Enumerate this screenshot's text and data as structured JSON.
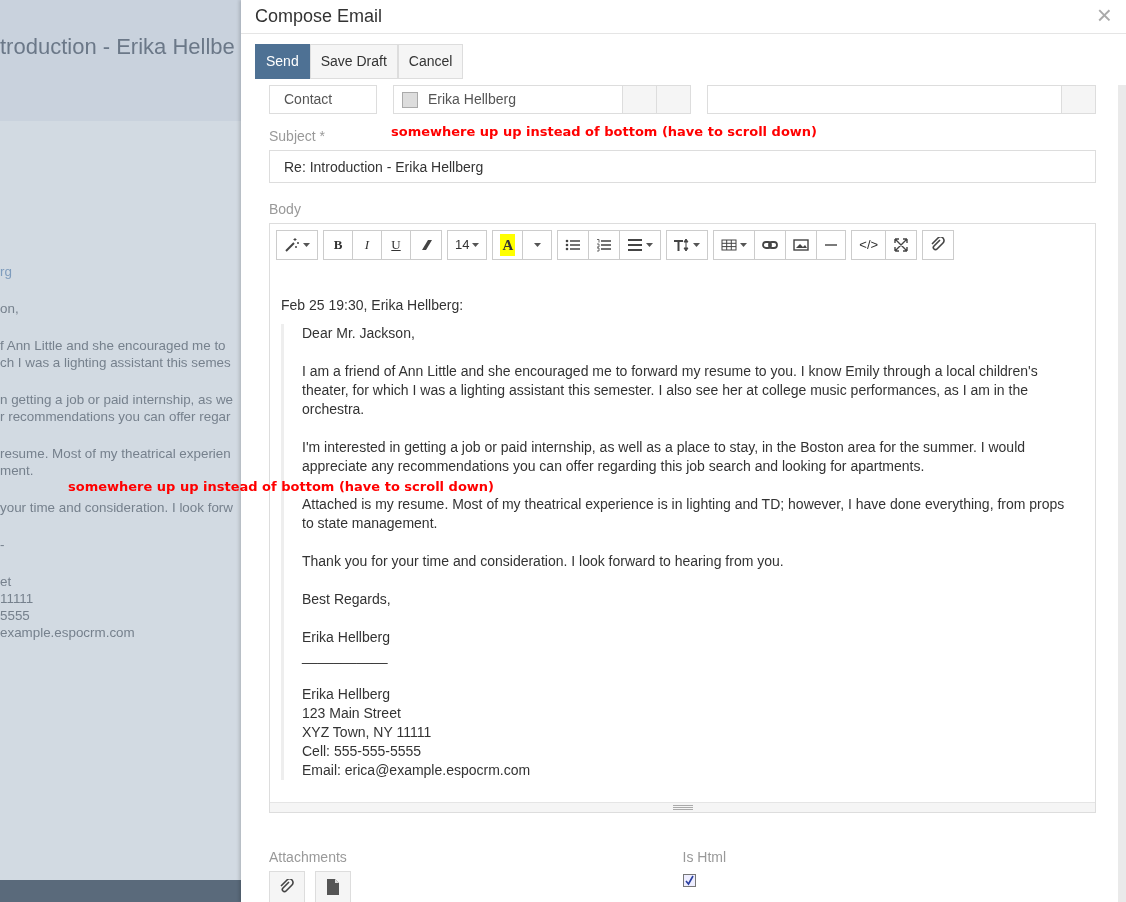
{
  "background_page": {
    "title": "troduction - Erika Hellbe",
    "paragraphs": [
      {
        "kind": "link",
        "lines": [
          "rg"
        ]
      },
      {
        "kind": "text",
        "lines": [
          "on,"
        ]
      },
      {
        "kind": "text",
        "lines": [
          "f Ann Little and she encouraged me to",
          "ch I was a lighting assistant this semes"
        ]
      },
      {
        "kind": "text",
        "lines": [
          "n getting a job or paid internship, as we",
          "r recommendations you can offer regar"
        ]
      },
      {
        "kind": "text",
        "lines": [
          "resume. Most of my theatrical experien",
          "ment."
        ]
      },
      {
        "kind": "text",
        "lines": [
          "your time and consideration. I look forw"
        ]
      },
      {
        "kind": "text",
        "lines": [
          "-"
        ]
      },
      {
        "kind": "text",
        "lines": [
          "et",
          "11111",
          "5555",
          "example.espocrm.com"
        ]
      }
    ]
  },
  "modal": {
    "title": "Compose Email",
    "close": "×",
    "buttons": [
      {
        "label": "Send",
        "kind": "primary"
      },
      {
        "label": "Save Draft",
        "kind": "default"
      },
      {
        "label": "Cancel",
        "kind": "default"
      }
    ],
    "parent_row": {
      "type": "Contact",
      "name": "Erika Hellberg",
      "checked": false
    },
    "subject": {
      "label": "Subject *",
      "value": "Re: Introduction - Erika Hellberg"
    },
    "body": {
      "label": "Body",
      "toolbar": [
        [
          {
            "kind": "wand",
            "caret": true
          }
        ],
        [
          {
            "kind": "bold",
            "label": "B",
            "caret": false
          },
          {
            "kind": "italic",
            "label": "I",
            "caret": false
          },
          {
            "kind": "underline",
            "label": "U",
            "caret": false
          },
          {
            "kind": "eraser",
            "caret": false
          }
        ],
        [
          {
            "kind": "text",
            "label": "14",
            "caret": true
          }
        ],
        [
          {
            "kind": "highlight",
            "label": "A",
            "caret": false
          },
          {
            "kind": "more",
            "caret": true
          }
        ],
        [
          {
            "kind": "bullets",
            "caret": false
          },
          {
            "kind": "numbers",
            "caret": false
          },
          {
            "kind": "align",
            "caret": true
          }
        ],
        [
          {
            "kind": "height",
            "caret": true
          }
        ],
        [
          {
            "kind": "table",
            "caret": true
          },
          {
            "kind": "link",
            "caret": false
          },
          {
            "kind": "picture",
            "caret": false
          },
          {
            "kind": "rule",
            "caret": false
          }
        ],
        [
          {
            "kind": "text",
            "label": "</>",
            "caret": false
          },
          {
            "kind": "fullscreen",
            "caret": false
          }
        ],
        [
          {
            "kind": "attach",
            "caret": false
          }
        ]
      ],
      "quote_header": "Feb 25 19:30, Erika Hellberg:",
      "quote": [
        [
          "Dear Mr. Jackson,"
        ],
        [
          "I am a friend of Ann Little and she encouraged me to forward my resume to you. I know Emily through a local children's theater, for which I was a lighting assistant this semester. I also see her at college music performances, as I am in the orchestra."
        ],
        [
          "I'm interested in getting a job or paid internship, as well as a place to stay, in the Boston area for the summer. I would appreciate any recommendations you can offer regarding this job search and looking for apartments."
        ],
        [
          "Attached is my resume. Most of my theatrical experience is in lighting and TD; however, I have done everything, from props to state management."
        ],
        [
          "Thank you for your time and consideration. I look forward to hearing from you."
        ],
        [
          "Best Regards,"
        ],
        [
          "Erika Hellberg",
          "___________"
        ],
        [
          "Erika Hellberg",
          "123 Main Street",
          "XYZ Town, NY 11111",
          "Cell: 555-555-5555",
          "Email: erica@example.espocrm.com"
        ]
      ]
    },
    "attachments": {
      "label": "Attachments"
    },
    "is_html": {
      "label": "Is Html",
      "checked": true
    }
  },
  "annotations": [
    "somewhere up up instead of bottom (have to scroll down)",
    "somewhere up up instead of bottom (have to scroll down)"
  ]
}
